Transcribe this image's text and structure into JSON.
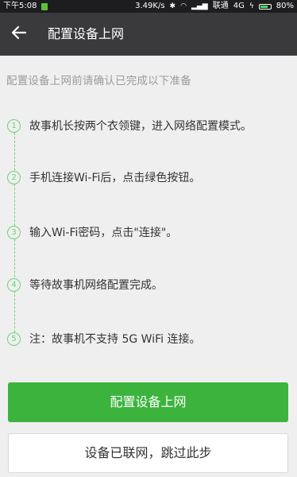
{
  "status_bar": {
    "time": "下午5:08",
    "speed": "3.49K/s",
    "carrier": "联通",
    "network": "4G",
    "battery_percent": "80%",
    "battery_level": 0.8,
    "icons": [
      "notification-icon",
      "bluetooth-icon",
      "wifi-icon",
      "signal-icon",
      "charging-icon",
      "battery-icon"
    ]
  },
  "header": {
    "title": "配置设备上网",
    "back_icon": "arrow-left-icon"
  },
  "intro": "配置设备上网前请确认已完成以下准备",
  "steps": [
    {
      "number": "1",
      "text": "故事机长按两个衣领键，进入网络配置模式。"
    },
    {
      "number": "2",
      "text": "手机连接Wi-Fi后，点击绿色按钮。"
    },
    {
      "number": "3",
      "text": "输入Wi-Fi密码，点击\"连接\"。"
    },
    {
      "number": "4",
      "text": "等待故事机网络配置完成。"
    },
    {
      "number": "5",
      "text": "注：故事机不支持 5G WiFi 连接。"
    }
  ],
  "buttons": {
    "primary": "配置设备上网",
    "secondary": "设备已联网，跳过此步"
  },
  "colors": {
    "accent_green": "#3cb33d",
    "timeline_green": "#6bd27b",
    "header_bg": "#3a3a3c",
    "page_bg": "#f0efef"
  }
}
